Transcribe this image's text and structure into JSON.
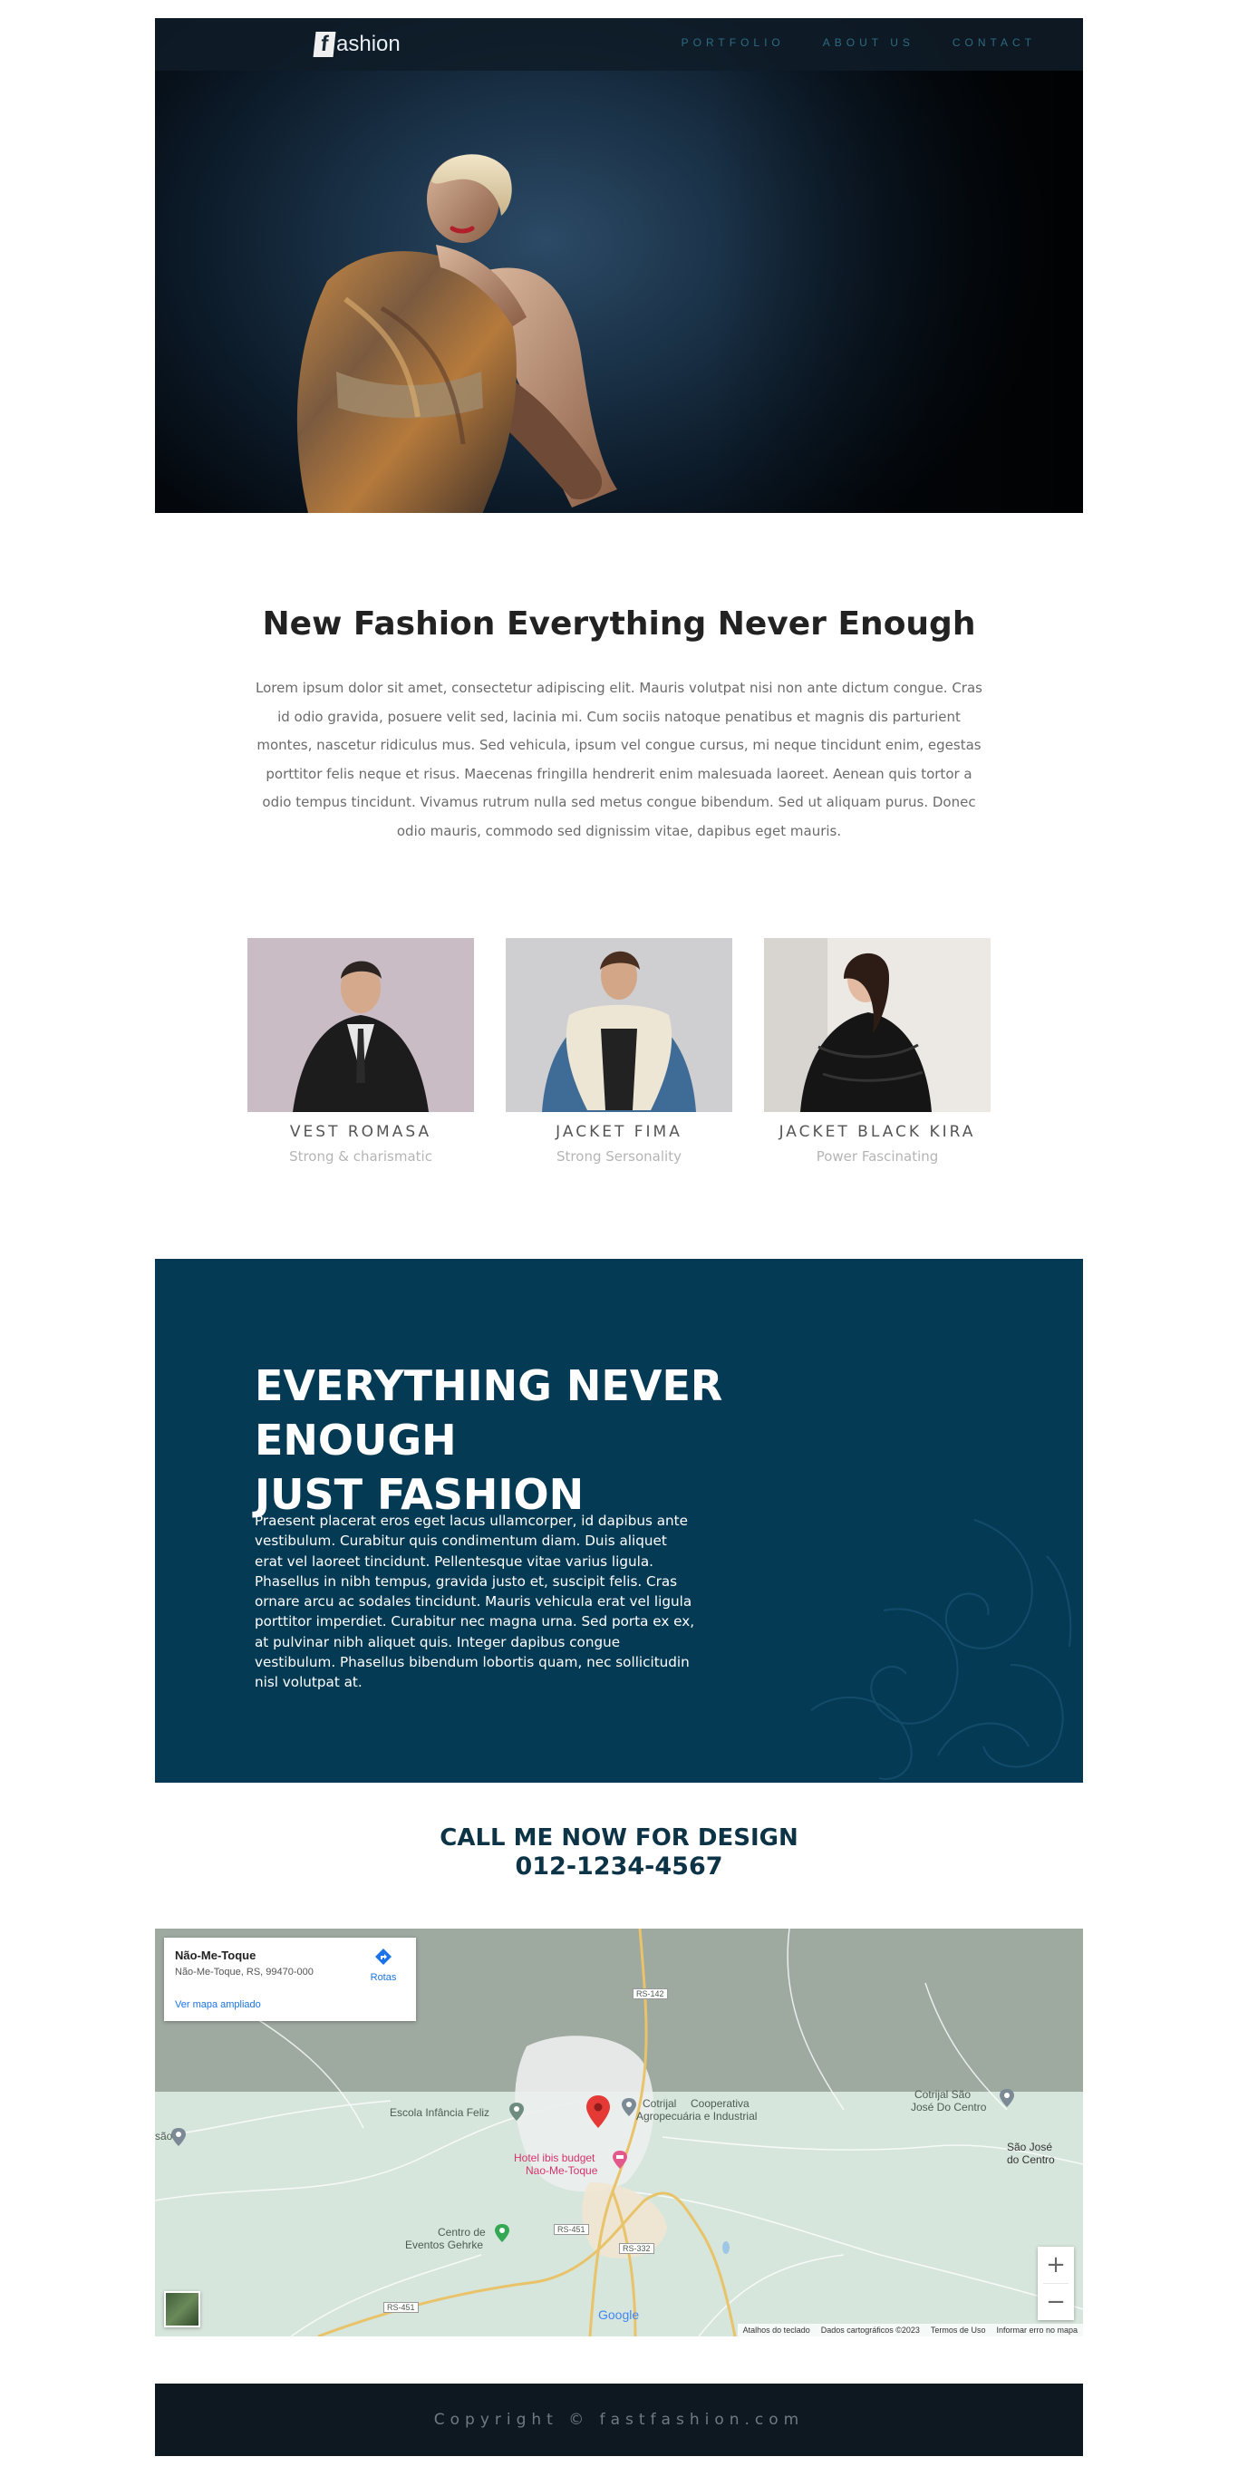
{
  "header": {
    "logo_letter": "f",
    "logo_text": "ashion",
    "nav": [
      {
        "label": "PORTFOLIO"
      },
      {
        "label": "ABOUT US"
      },
      {
        "label": "CONTACT"
      }
    ]
  },
  "intro": {
    "title": "New Fashion Everything Never Enough",
    "text": "Lorem ipsum dolor sit amet, consectetur adipiscing elit. Mauris volutpat nisi non ante dictum congue. Cras id odio gravida, posuere velit sed, lacinia mi. Cum sociis natoque penatibus et magnis dis parturient montes, nascetur ridiculus mus. Sed vehicula, ipsum vel congue cursus, mi neque tincidunt enim, egestas porttitor felis neque et risus. Maecenas fringilla hendrerit enim malesuada laoreet. Aenean quis tortor a odio tempus tincidunt. Vivamus rutrum nulla sed metus congue bibendum. Sed ut aliquam purus. Donec odio mauris, commodo sed dignissim vitae, dapibus eget mauris."
  },
  "products": [
    {
      "name": "VEST ROMASA",
      "subtitle": "Strong & charismatic"
    },
    {
      "name": "JACKET FIMA",
      "subtitle": "Strong Sersonality"
    },
    {
      "name": "JACKET BLACK KIRA",
      "subtitle": "Power Fascinating"
    }
  ],
  "banner": {
    "title_line1": "EVERYTHING NEVER ENOUGH",
    "title_line2": "JUST FASHION",
    "text": "Praesent placerat eros eget lacus ullamcorper, id dapibus ante vestibulum. Curabitur quis condimentum diam. Duis aliquet erat vel laoreet tincidunt. Pellentesque vitae varius ligula. Phasellus in nibh tempus, gravida justo et, suscipit felis. Cras ornare arcu ac sodales tincidunt. Mauris vehicula erat vel ligula porttitor imperdiet. Curabitur nec magna urna. Sed porta ex ex, at pulvinar nibh aliquet quis. Integer dapibus congue vestibulum. Phasellus bibendum lobortis quam, nec sollicitudin nisl volutpat at."
  },
  "call": {
    "line1": "CALL ME NOW FOR DESIGN",
    "phone": "012-1234-4567"
  },
  "map": {
    "place_name": "Não-Me-Toque",
    "place_address": "Não-Me-Toque, RS, 99470-000",
    "directions_label": "Rotas",
    "larger_map_link": "Ver mapa ampliado",
    "labels": {
      "escola": "Escola Infância Feliz",
      "cotrijal": "Cotrijal",
      "cooperativa_1": "Cooperativa",
      "cooperativa_2": "Agropecuária e Industrial",
      "hotel_1": "Hotel ibis budget",
      "hotel_2": "Nao-Me-Toque",
      "centro_1": "Centro de",
      "centro_2": "Eventos Gehrke",
      "cotrijal_sao_1": "Cotrijal São",
      "cotrijal_sao_2": "José Do Centro",
      "sao_jose_1": "São José",
      "sao_jose_2": "do Centro",
      "left_cut": "são",
      "rs142": "RS-142",
      "rs451a": "RS-451",
      "rs332": "RS-332",
      "rs451b": "RS-451"
    },
    "zoom_in": "+",
    "zoom_out": "−",
    "google": "Google",
    "footer": {
      "shortcuts": "Atalhos do teclado",
      "data": "Dados cartográficos ©2023",
      "terms": "Termos de Uso",
      "report": "Informar erro no mapa"
    }
  },
  "footer": {
    "copyright": "Copyright © fastfashion.com"
  },
  "colors": {
    "banner_bg": "#053a55",
    "call_text": "#0d3346",
    "footer_bg": "#0e1820",
    "nav_link": "#2d6b82",
    "map_link": "#1a73e8",
    "pin": "#e53935"
  }
}
